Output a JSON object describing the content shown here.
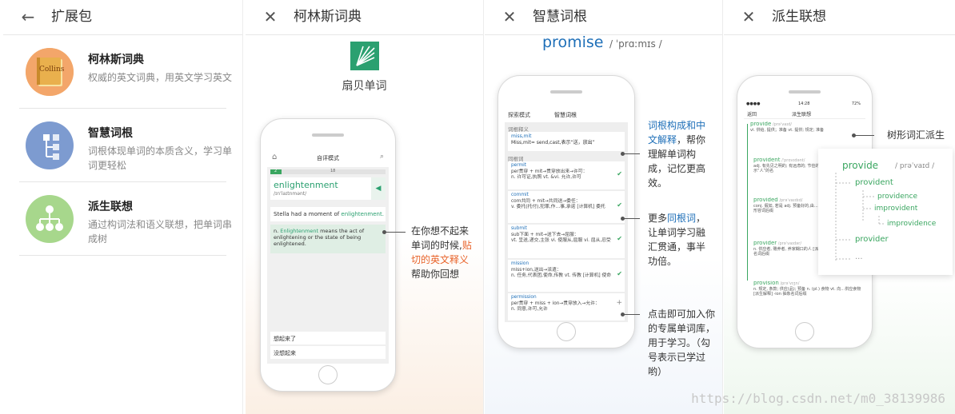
{
  "panel1": {
    "title": "扩展包",
    "items": [
      {
        "name": "柯林斯词典",
        "desc": "权威的英文词典，用英文学习英文",
        "badge": "Collins"
      },
      {
        "name": "智慧词根",
        "desc": "词根体现单词的本质含义，学习单词更轻松"
      },
      {
        "name": "派生联想",
        "desc": "通过构词法和语义联想，把单词串成树"
      }
    ]
  },
  "panel2": {
    "title": "柯林斯词典",
    "brand": "扇贝单词",
    "screen": {
      "mode": "自评模式",
      "progress_a": "2",
      "progress_b": "18",
      "word": "enlightenment",
      "phon": "/ɪn'laɪtnmənt/",
      "sentence_pre": "Stella had a moment of ",
      "sentence_word": "enlightenment.",
      "def_pre": "n. ",
      "def_word": "Enlightenment",
      "def_rest": " means the act of enlightening or the state of being enlightened.",
      "btn1": "想起来了",
      "btn2": "没想起来"
    },
    "caption_a": "在你想不起来单词的时候,",
    "caption_b": "贴切的英文释义",
    "caption_c": "帮助你回想"
  },
  "panel3": {
    "title": "智慧词根",
    "word": "promise",
    "phon": "/ ˈprɑːmɪs /",
    "screen": {
      "back": "探索模式",
      "mode": "智慧词根",
      "sec1": "词根释义",
      "root": "miss,mit",
      "root_desc": "Miss,mit= send,cast,表示“送，放出”",
      "sec2": "同根词",
      "words": [
        {
          "w": "permit",
          "l1": "per贯穿 + mit→贯穿放出来→许可：",
          "l2": "n. 许可证,执照 vt. &vi. 允许,许可"
        },
        {
          "w": "commit",
          "l1": "com共同 + mit→共同送→委任：",
          "l2": "v. 委托(托付),犯罪,作…事,承诺 [计算机] 委托"
        },
        {
          "w": "submit",
          "l1": "sub下面 + mit→送下去→屈服：",
          "l2": "vt. 呈送,递交,主张 vi. 使服从,屈服 vi. 屈从,忍受"
        },
        {
          "w": "mission",
          "l1": "miss+ion,送出→派遣：",
          "l2": "n. 任务,代表团,使命,传教 vt. 传教 [计算机] 使命"
        },
        {
          "w": "permission",
          "l1": "per贯穿 + miss + ion→贯穿放入→允许：",
          "l2": "n. 同意,许可,允许"
        }
      ]
    },
    "cap1_a": "词根构成和中文",
    "cap1_b": "解释",
    "cap1_c": "，帮你理解单词构成，记忆更高效。",
    "cap2_a": "更多",
    "cap2_b": "同根词",
    "cap2_c": "，让单词学习融汇贯通，事半功倍。",
    "cap3": "点击即可加入你的专属单词库，用于学习。（勾号表示已学过哟）"
  },
  "panel4": {
    "title": "派生联想",
    "screen": {
      "time": "14:28",
      "battery": "72%",
      "back": "返回",
      "mode": "派生联想",
      "entries": [
        {
          "w": "provide",
          "p": "/prəˈvaɪd/",
          "d": "vi. 供给, 提供；准备 vt. 提供; 规定; 准备"
        },
        {
          "w": "provident",
          "p": "/ˈprɑvɪdənt/",
          "d": "adj. 有先见之明的; 有远虑的; 节俭的 [派生解释] -ent 表示“人”的名 "
        },
        {
          "w": "provided",
          "p": "/prəˈvaɪdɪd/",
          "d": "conj. 假如, 若是 adj. 预备好的,由…供给的 [派生解释] -ed 形容词后缀"
        },
        {
          "w": "provider",
          "p": "/prəˈvaɪdər/",
          "d": "n. 供应者, 赡养者, 养家糊口的人 [派生解释] -er 表示“人”的名词后缀"
        },
        {
          "w": "provision",
          "p": "/prəˈvɪʒn/",
          "d": "n. 规定, 条款; 供应(品); 预备 n. (pl.) 食物 vt. 向…供应食物 [派生解释] -ion 抽象名词后缀"
        }
      ]
    },
    "tree_label": "树形词汇派生",
    "tree": {
      "root": "provide",
      "root_phon": "/ prəˈvaɪd /",
      "n1": "provident",
      "n2": "providence",
      "n3": "improvident",
      "n4": "improvidence",
      "n5": "provider",
      "n6": "..."
    }
  },
  "watermark": "https://blog.csdn.net/m0_38139986",
  "colors": {
    "green": "#3aa660",
    "orange": "#e8632a",
    "blue": "#1e6fb8",
    "collins_bg": "#f3a66a",
    "root_bg": "#7d9bd0",
    "tree_bg": "#a7d78c"
  }
}
